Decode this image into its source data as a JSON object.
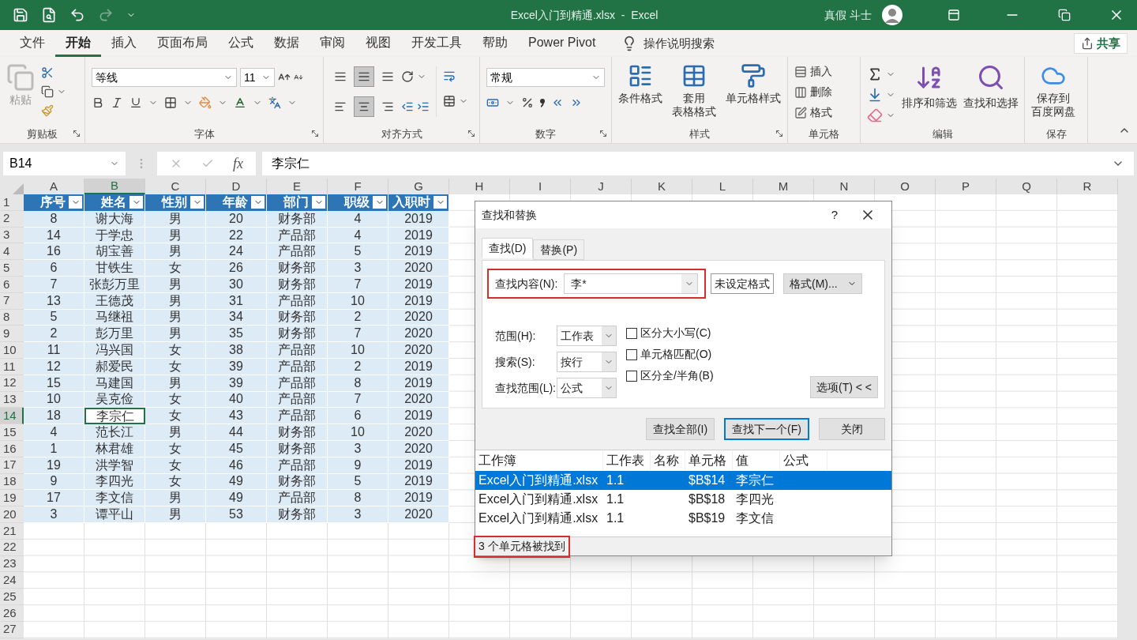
{
  "title_bar": {
    "title": "Excel入门到精通.xlsx  -  Excel",
    "user": "真假 斗士"
  },
  "menu_tabs": [
    {
      "label": "文件",
      "selected": false
    },
    {
      "label": "开始",
      "selected": true
    },
    {
      "label": "插入",
      "selected": false
    },
    {
      "label": "页面布局",
      "selected": false
    },
    {
      "label": "公式",
      "selected": false
    },
    {
      "label": "数据",
      "selected": false
    },
    {
      "label": "审阅",
      "selected": false
    },
    {
      "label": "视图",
      "selected": false
    },
    {
      "label": "开发工具",
      "selected": false
    },
    {
      "label": "帮助",
      "selected": false
    },
    {
      "label": "Power Pivot",
      "selected": false
    }
  ],
  "tell_me": "操作说明搜索",
  "share": "共享",
  "ribbon": {
    "clipboard": {
      "paste": "粘贴",
      "label": "剪贴板"
    },
    "font": {
      "name": "等线",
      "size": "11",
      "label": "字体"
    },
    "alignment": {
      "label": "对齐方式"
    },
    "number": {
      "format": "常规",
      "label": "数字"
    },
    "styles": {
      "buttons": [
        [
          "条件格式"
        ],
        [
          "套用",
          "表格格式"
        ],
        [
          "单元格样式"
        ]
      ],
      "label": "样式"
    },
    "cells": {
      "buttons": [
        "插入",
        "删除",
        "格式"
      ],
      "label": "单元格"
    },
    "editing": {
      "buttons": [
        "排序和筛选",
        "查找和选择"
      ],
      "label": "编辑"
    },
    "save": {
      "button": [
        "保存到",
        "百度网盘"
      ],
      "label": "保存"
    }
  },
  "formula_bar": {
    "name_box": "B14",
    "fx": "fx",
    "value": "李宗仁"
  },
  "sheet": {
    "columns": [
      {
        "label": "A",
        "selected": false
      },
      {
        "label": "B",
        "selected": true
      },
      {
        "label": "C",
        "selected": false
      },
      {
        "label": "D",
        "selected": false
      },
      {
        "label": "E",
        "selected": false
      },
      {
        "label": "F",
        "selected": false
      },
      {
        "label": "G",
        "selected": false
      },
      {
        "label": "H",
        "selected": false
      },
      {
        "label": "I",
        "selected": false
      },
      {
        "label": "J",
        "selected": false
      },
      {
        "label": "K",
        "selected": false
      },
      {
        "label": "L",
        "selected": false
      },
      {
        "label": "M",
        "selected": false
      },
      {
        "label": "N",
        "selected": false
      },
      {
        "label": "O",
        "selected": false
      },
      {
        "label": "P",
        "selected": false
      },
      {
        "label": "Q",
        "selected": false
      },
      {
        "label": "R",
        "selected": false
      }
    ],
    "row_labels": [
      "1",
      "2",
      "3",
      "4",
      "5",
      "6",
      "7",
      "8",
      "9",
      "10",
      "11",
      "12",
      "13",
      "14",
      "15",
      "16",
      "17",
      "18",
      "19",
      "20",
      "21",
      "22",
      "23",
      "24",
      "25",
      "26",
      "27"
    ],
    "headers": [
      "序号",
      "姓名",
      "性别",
      "年龄",
      "部门",
      "职级",
      "入职时"
    ],
    "rows": [
      {
        "cells": [
          "8",
          "谢大海",
          "男",
          "20",
          "财务部",
          "4",
          "2019"
        ],
        "selected": false
      },
      {
        "cells": [
          "14",
          "于学忠",
          "男",
          "22",
          "产品部",
          "4",
          "2019"
        ],
        "selected": false
      },
      {
        "cells": [
          "16",
          "胡宝善",
          "男",
          "24",
          "产品部",
          "5",
          "2019"
        ],
        "selected": false
      },
      {
        "cells": [
          "6",
          "甘铁生",
          "女",
          "26",
          "财务部",
          "3",
          "2020"
        ],
        "selected": false
      },
      {
        "cells": [
          "7",
          "张彭万里",
          "男",
          "30",
          "财务部",
          "7",
          "2019"
        ],
        "selected": false
      },
      {
        "cells": [
          "13",
          "王德茂",
          "男",
          "31",
          "产品部",
          "10",
          "2019"
        ],
        "selected": false
      },
      {
        "cells": [
          "5",
          "马继祖",
          "男",
          "34",
          "财务部",
          "2",
          "2020"
        ],
        "selected": false
      },
      {
        "cells": [
          "2",
          "彭万里",
          "男",
          "35",
          "财务部",
          "7",
          "2020"
        ],
        "selected": false
      },
      {
        "cells": [
          "11",
          "冯兴国",
          "女",
          "38",
          "产品部",
          "10",
          "2020"
        ],
        "selected": false
      },
      {
        "cells": [
          "12",
          "郝爱民",
          "女",
          "39",
          "产品部",
          "2",
          "2019"
        ],
        "selected": false
      },
      {
        "cells": [
          "15",
          "马建国",
          "男",
          "39",
          "产品部",
          "8",
          "2019"
        ],
        "selected": false
      },
      {
        "cells": [
          "10",
          "吴克俭",
          "女",
          "40",
          "产品部",
          "7",
          "2020"
        ],
        "selected": false
      },
      {
        "cells": [
          "18",
          "李宗仁",
          "女",
          "43",
          "产品部",
          "6",
          "2019"
        ],
        "selected": true
      },
      {
        "cells": [
          "4",
          "范长江",
          "男",
          "44",
          "财务部",
          "10",
          "2020"
        ],
        "selected": false
      },
      {
        "cells": [
          "1",
          "林君雄",
          "女",
          "45",
          "财务部",
          "3",
          "2020"
        ],
        "selected": false
      },
      {
        "cells": [
          "19",
          "洪学智",
          "女",
          "46",
          "产品部",
          "9",
          "2019"
        ],
        "selected": false
      },
      {
        "cells": [
          "9",
          "李四光",
          "女",
          "49",
          "财务部",
          "5",
          "2019"
        ],
        "selected": false
      },
      {
        "cells": [
          "17",
          "李文信",
          "男",
          "49",
          "产品部",
          "8",
          "2019"
        ],
        "selected": false
      },
      {
        "cells": [
          "3",
          "谭平山",
          "男",
          "53",
          "财务部",
          "3",
          "2020"
        ],
        "selected": false
      }
    ]
  },
  "dialog": {
    "title": "查找和替换",
    "help": "?",
    "tabs": [
      {
        "label": "查找(D)",
        "selected": true
      },
      {
        "label": "替换(P)",
        "selected": false
      }
    ],
    "find": {
      "label": "查找内容(N):",
      "value": "李*",
      "highlighted": true
    },
    "no_format": "未设定格式",
    "format_button": "格式(M)...",
    "options": [
      {
        "label": "范围(H):",
        "value": "工作表"
      },
      {
        "label": "搜索(S):",
        "value": "按行"
      },
      {
        "label": "查找范围(L):",
        "value": "公式"
      }
    ],
    "checkboxes": [
      {
        "label": "区分大小写(C)",
        "checked": false
      },
      {
        "label": "单元格匹配(O)",
        "checked": false
      },
      {
        "label": "区分全/半角(B)",
        "checked": false
      }
    ],
    "options_button": "选项(T) < <",
    "buttons": [
      {
        "label": "查找全部(I)",
        "selected": false
      },
      {
        "label": "查找下一个(F)",
        "selected": true
      },
      {
        "label": "关闭",
        "selected": false
      }
    ],
    "results": {
      "columns": [
        "工作簿",
        "工作表",
        "名称",
        "单元格",
        "值",
        "公式"
      ],
      "rows": [
        {
          "cells": [
            "Excel入门到精通.xlsx",
            "1.1",
            "",
            "$B$14",
            "李宗仁",
            ""
          ],
          "selected": true
        },
        {
          "cells": [
            "Excel入门到精通.xlsx",
            "1.1",
            "",
            "$B$18",
            "李四光",
            ""
          ],
          "selected": false
        },
        {
          "cells": [
            "Excel入门到精通.xlsx",
            "1.1",
            "",
            "$B$19",
            "李文信",
            ""
          ],
          "selected": false
        }
      ]
    },
    "status": {
      "text": "3 个单元格被找到",
      "highlighted": true
    }
  }
}
